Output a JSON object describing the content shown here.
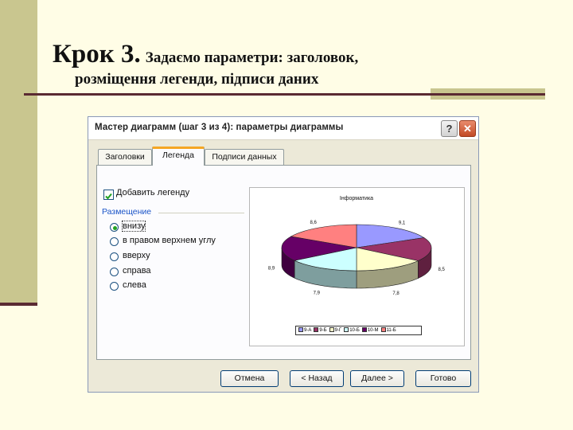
{
  "slide": {
    "title_main": "Крок 3.",
    "title_sub": "Задаємо параметри: заголовок,",
    "title_line2": "розміщення легенди, підписи даних"
  },
  "dialog": {
    "title": "Мастер диаграмм (шаг 3 из 4): параметры диаграммы",
    "help_label": "?",
    "close_label": "✕",
    "tabs": [
      {
        "label": "Заголовки",
        "active": false
      },
      {
        "label": "Легенда",
        "active": true
      },
      {
        "label": "Подписи данных",
        "active": false
      }
    ],
    "legend_checkbox": {
      "label": "Добавить легенду",
      "checked": true
    },
    "placement_group": "Размещение",
    "placement_options": [
      {
        "label": "внизу",
        "selected": true
      },
      {
        "label": "в правом верхнем углу",
        "selected": false
      },
      {
        "label": "вверху",
        "selected": false
      },
      {
        "label": "справа",
        "selected": false
      },
      {
        "label": "слева",
        "selected": false
      }
    ],
    "buttons": {
      "cancel": "Отмена",
      "back": "< Назад",
      "next": "Далее >",
      "finish": "Готово"
    }
  },
  "chart_data": {
    "type": "pie",
    "title": "Інформатика",
    "legend_position": "bottom",
    "categories": [
      "9-А",
      "9-Б",
      "9-Г",
      "10-Б",
      "10-М",
      "11-Б"
    ],
    "values": [
      9.1,
      8.5,
      7.8,
      7.9,
      8.9,
      8.6
    ],
    "value_labels": [
      "9,1",
      "8,5",
      "7,8",
      "7,9",
      "8,9",
      "8,6"
    ],
    "colors": [
      "#9999ff",
      "#993366",
      "#ffffcc",
      "#ccffff",
      "#660066",
      "#ff8080"
    ]
  }
}
